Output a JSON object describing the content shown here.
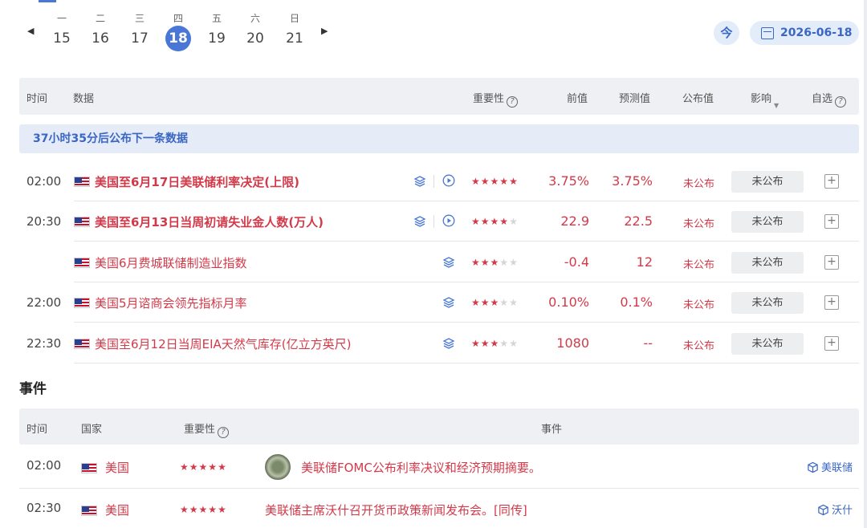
{
  "colors": {
    "accent": "#4a77d6",
    "red": "#d23a4a",
    "header_bg": "#eef0f3",
    "notice_bg": "#e5ebf7"
  },
  "week": {
    "days": [
      {
        "weekday": "一",
        "date": "15"
      },
      {
        "weekday": "二",
        "date": "16"
      },
      {
        "weekday": "三",
        "date": "17"
      },
      {
        "weekday": "四",
        "date": "18",
        "active": true
      },
      {
        "weekday": "五",
        "date": "19"
      },
      {
        "weekday": "六",
        "date": "20"
      },
      {
        "weekday": "日",
        "date": "21"
      }
    ],
    "prev_icon": "chevron-left-icon",
    "next_icon": "chevron-right-icon",
    "today_label": "今",
    "date_label": "2026-06-18"
  },
  "table": {
    "headers": {
      "time": "时间",
      "data": "数据",
      "importance": "重要性",
      "prev": "前值",
      "forecast": "预测值",
      "actual": "公布值",
      "impact": "影响",
      "watch": "自选"
    },
    "notice": "37小时35分后公布下一条数据",
    "rows": [
      {
        "time": "02:00",
        "title": "美国至6月17日美联储利率决定(上限)",
        "bold": true,
        "video": true,
        "stars": 5,
        "prev": "3.75%",
        "forecast": "3.75%",
        "actual": "未公布",
        "impact": "未公布"
      },
      {
        "time": "20:30",
        "title": "美国至6月13日当周初请失业金人数(万人)",
        "bold": true,
        "video": true,
        "stars": 4,
        "prev": "22.9",
        "forecast": "22.5",
        "actual": "未公布",
        "impact": "未公布"
      },
      {
        "time": "",
        "title": "美国6月费城联储制造业指数",
        "bold": false,
        "video": false,
        "stars": 3,
        "prev": "-0.4",
        "forecast": "12",
        "actual": "未公布",
        "impact": "未公布"
      },
      {
        "time": "22:00",
        "title": "美国5月谘商会领先指标月率",
        "bold": false,
        "video": false,
        "stars": 3,
        "prev": "0.10%",
        "forecast": "0.1%",
        "actual": "未公布",
        "impact": "未公布"
      },
      {
        "time": "22:30",
        "title": "美国至6月12日当周EIA天然气库存(亿立方英尺)",
        "bold": false,
        "video": false,
        "stars": 3,
        "prev": "1080",
        "forecast": "--",
        "actual": "未公布",
        "impact": "未公布"
      }
    ]
  },
  "events": {
    "title": "事件",
    "headers": {
      "time": "时间",
      "country": "国家",
      "importance": "重要性",
      "event": "事件"
    },
    "rows": [
      {
        "time": "02:00",
        "country": "美国",
        "stars": 5,
        "has_seal": true,
        "text": "美联储FOMC公布利率决议和经济预期摘要。",
        "tag": "美联储"
      },
      {
        "time": "02:30",
        "country": "美国",
        "stars": 5,
        "has_seal": false,
        "text": "美联储主席沃什召开货币政策新闻发布会。[同传]",
        "tag": "沃什"
      }
    ]
  }
}
